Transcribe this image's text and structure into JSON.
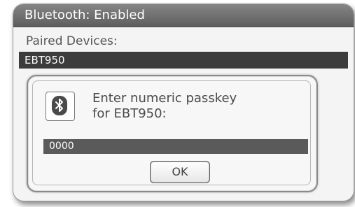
{
  "window": {
    "title": "Bluetooth: Enabled"
  },
  "paired_devices": {
    "label": "Paired Devices:",
    "items": [
      {
        "name": "EBT950",
        "selected": true
      }
    ]
  },
  "dialog": {
    "icon": "bluetooth-icon",
    "prompt_line1": "Enter numeric passkey",
    "prompt_line2": "for EBT950:",
    "passkey_value": "0000",
    "ok_label": "OK"
  },
  "colors": {
    "titlebar": "#6e6e6e",
    "selected_row": "#3c3c3c",
    "passkey_field": "#5a5a5a"
  }
}
